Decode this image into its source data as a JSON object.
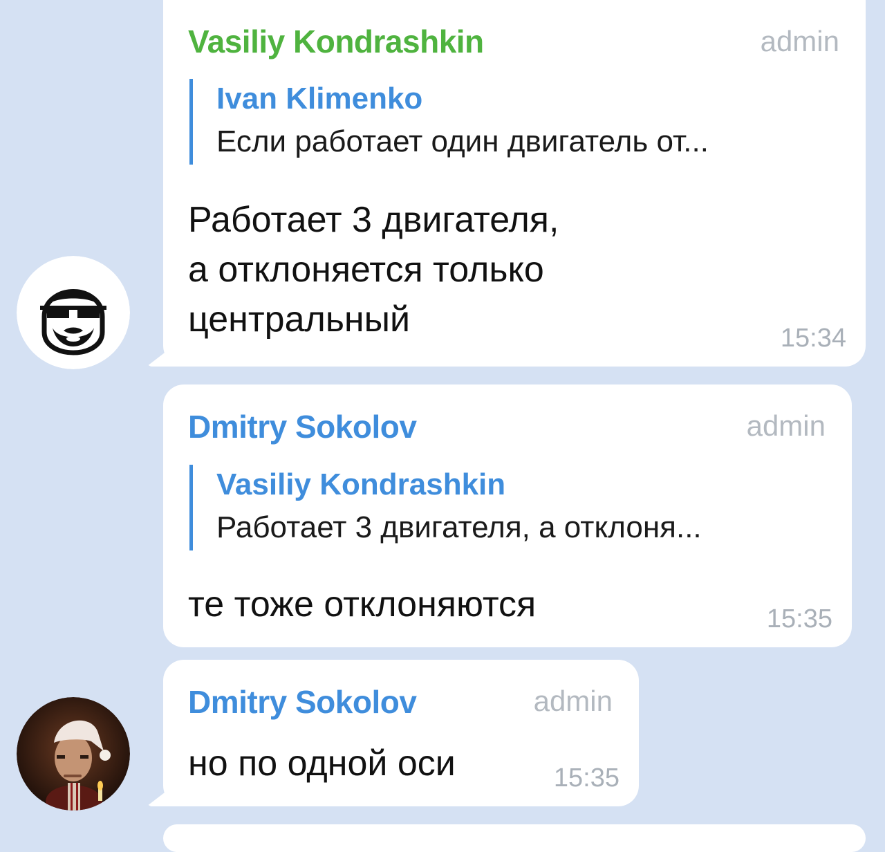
{
  "messages": [
    {
      "sender": "Vasiliy Kondrashkin",
      "role": "admin",
      "reply_to": {
        "name": "Ivan Klimenko",
        "text": "Если работает один двигатель от..."
      },
      "text": "Работает 3 двигателя,\nа отклоняется только\nцентральный",
      "time": "15:34",
      "avatar": "bearded-man-with-sunglasses-icon"
    },
    {
      "sender": "Dmitry Sokolov",
      "role": "admin",
      "reply_to": {
        "name": "Vasiliy Kondrashkin",
        "text": "Работает 3 двигателя, а отклоня..."
      },
      "text": "те тоже отклоняются",
      "time": "15:35"
    },
    {
      "sender": "Dmitry Sokolov",
      "role": "admin",
      "text": "но по одной оси",
      "time": "15:35",
      "avatar": "man-in-santa-hat-photo"
    }
  ],
  "colors": {
    "background": "#d5e1f3",
    "sender_green": "#4fb33f",
    "sender_blue": "#3f8ddc",
    "reply_bar": "#3f8ddc",
    "meta_gray": "#a9b0b8"
  }
}
